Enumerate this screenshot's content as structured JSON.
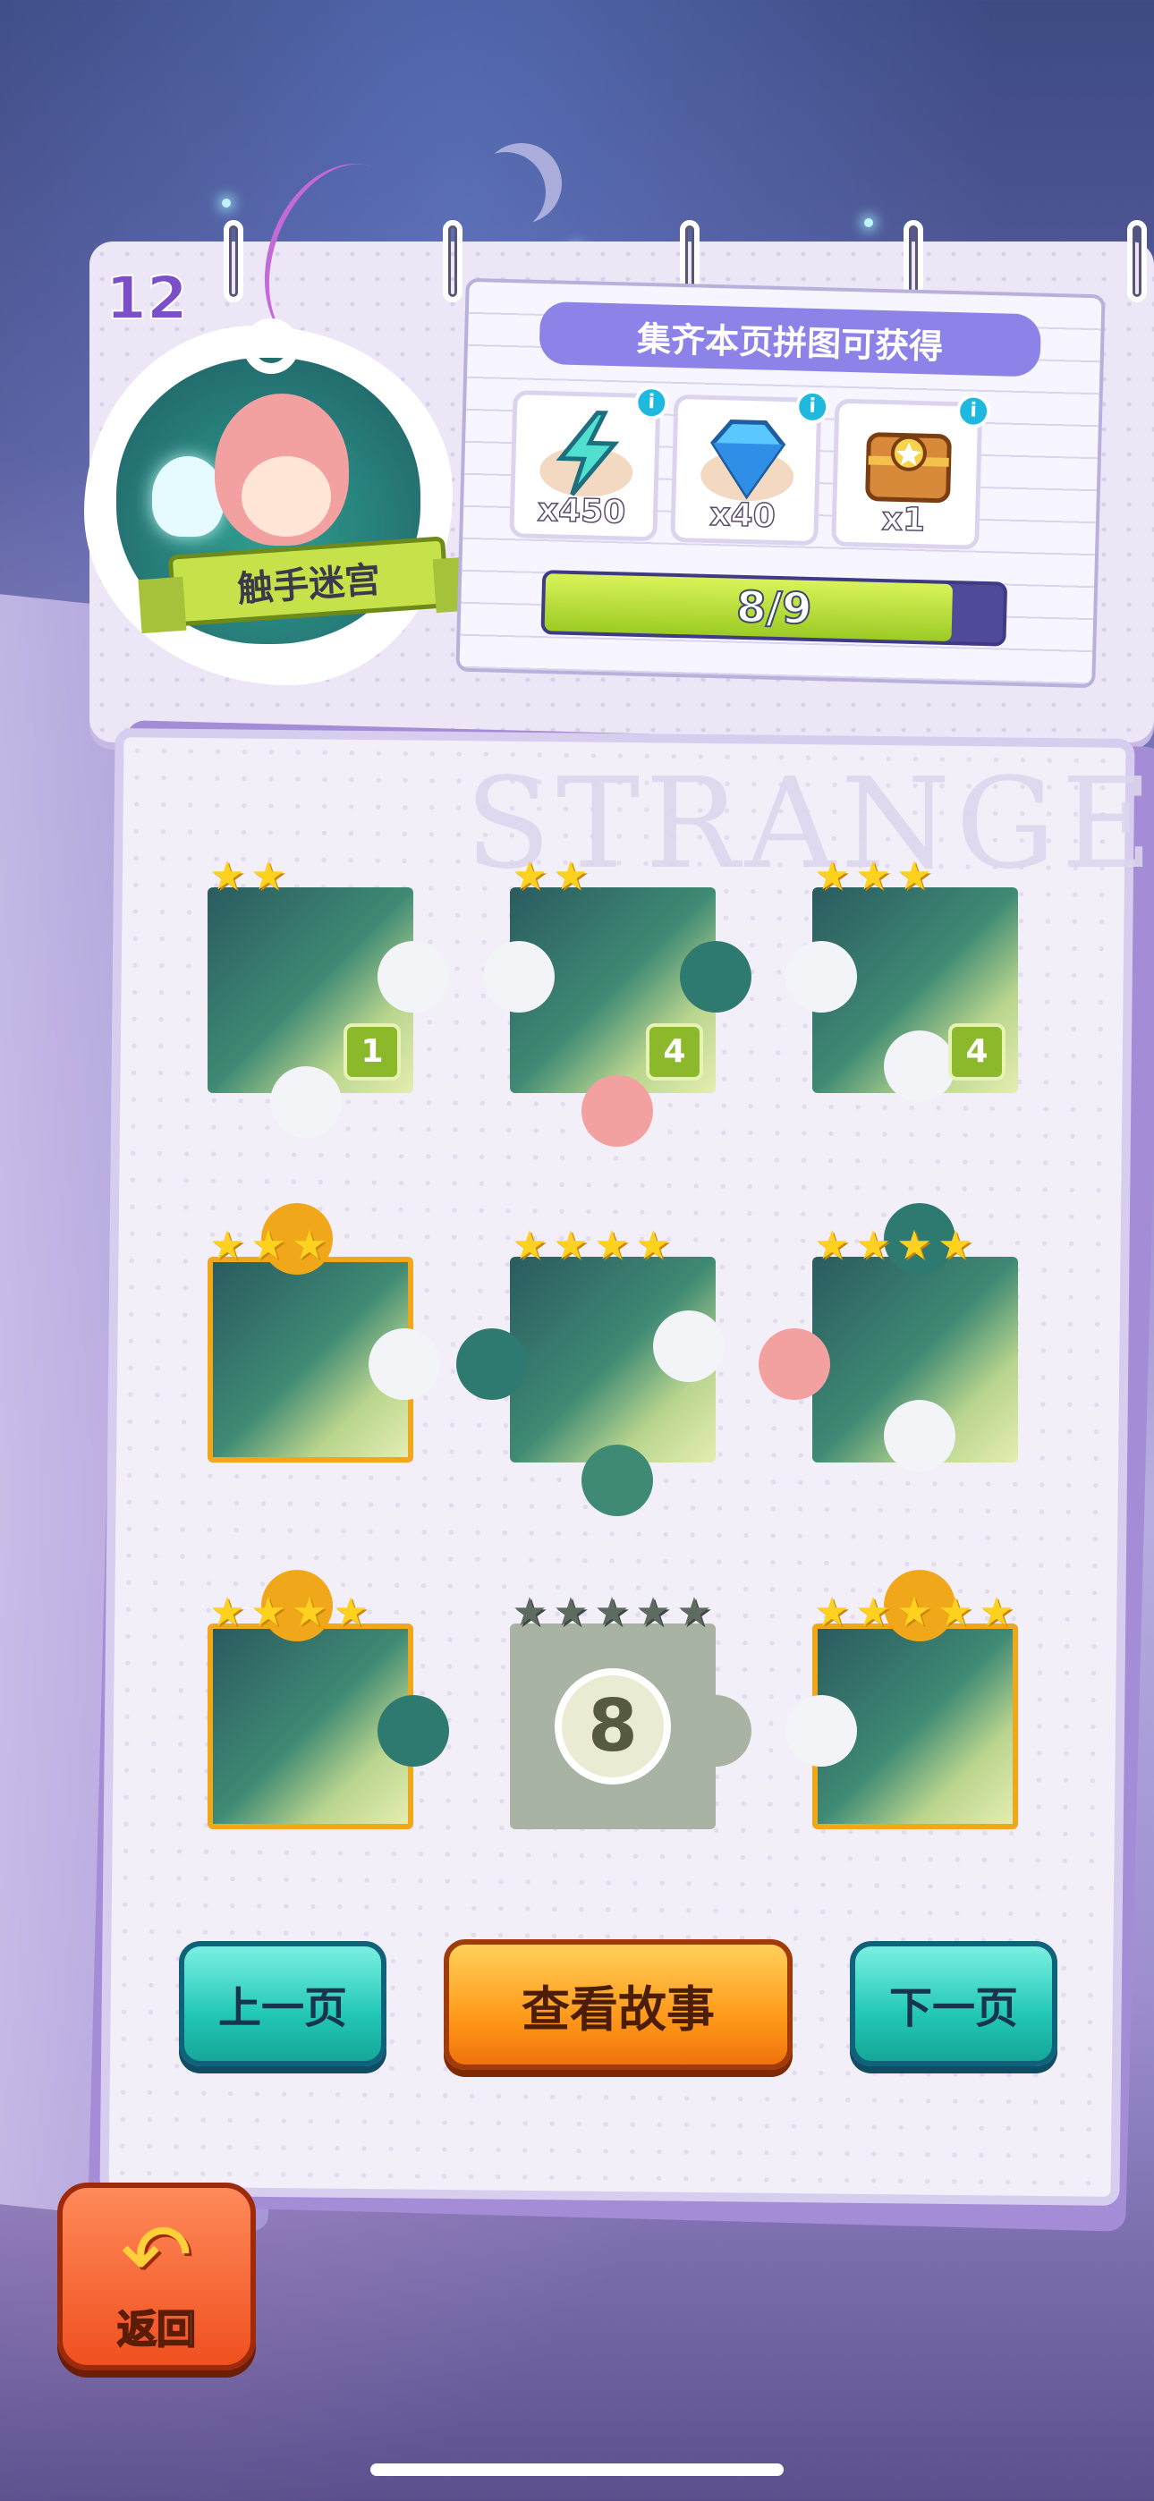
{
  "level": {
    "number": "12",
    "name": "触手迷宫"
  },
  "rewards": {
    "title": "集齐本页拼图可获得",
    "items": [
      {
        "icon": "lightning-energy-icon",
        "qty": "x450",
        "info": "i"
      },
      {
        "icon": "blue-diamond-icon",
        "qty": "x40",
        "info": "i"
      },
      {
        "icon": "treasure-chest-icon",
        "qty": "x1",
        "info": "i"
      }
    ],
    "progress_text": "8/9",
    "progress_value": 0.889
  },
  "watermark": "STRANGE",
  "pieces": [
    {
      "stars": 2,
      "max_stars": 2,
      "count": "1",
      "frame": "plain",
      "locked": false
    },
    {
      "stars": 2,
      "max_stars": 2,
      "count": "4",
      "frame": "plain",
      "locked": false
    },
    {
      "stars": 3,
      "max_stars": 3,
      "count": "4",
      "frame": "plain",
      "locked": false
    },
    {
      "stars": 3,
      "max_stars": 3,
      "count": "",
      "frame": "gold",
      "locked": false
    },
    {
      "stars": 4,
      "max_stars": 4,
      "count": "",
      "frame": "plain",
      "locked": false
    },
    {
      "stars": 4,
      "max_stars": 4,
      "count": "",
      "frame": "plain",
      "locked": false
    },
    {
      "stars": 4,
      "max_stars": 4,
      "count": "",
      "frame": "gold",
      "locked": false
    },
    {
      "stars": 0,
      "max_stars": 5,
      "count": "",
      "frame": "plain",
      "locked": true,
      "lock_number": "8"
    },
    {
      "stars": 5,
      "max_stars": 5,
      "count": "",
      "frame": "gold",
      "locked": false
    }
  ],
  "buttons": {
    "prev": "上一页",
    "story": "查看故事",
    "next": "下一页",
    "back": "返回"
  },
  "colors": {
    "accent_green": "#8cb82c",
    "star_gold": "#ffd21f",
    "teal_button": "#22c7b6",
    "orange_button": "#ff9a1a"
  }
}
